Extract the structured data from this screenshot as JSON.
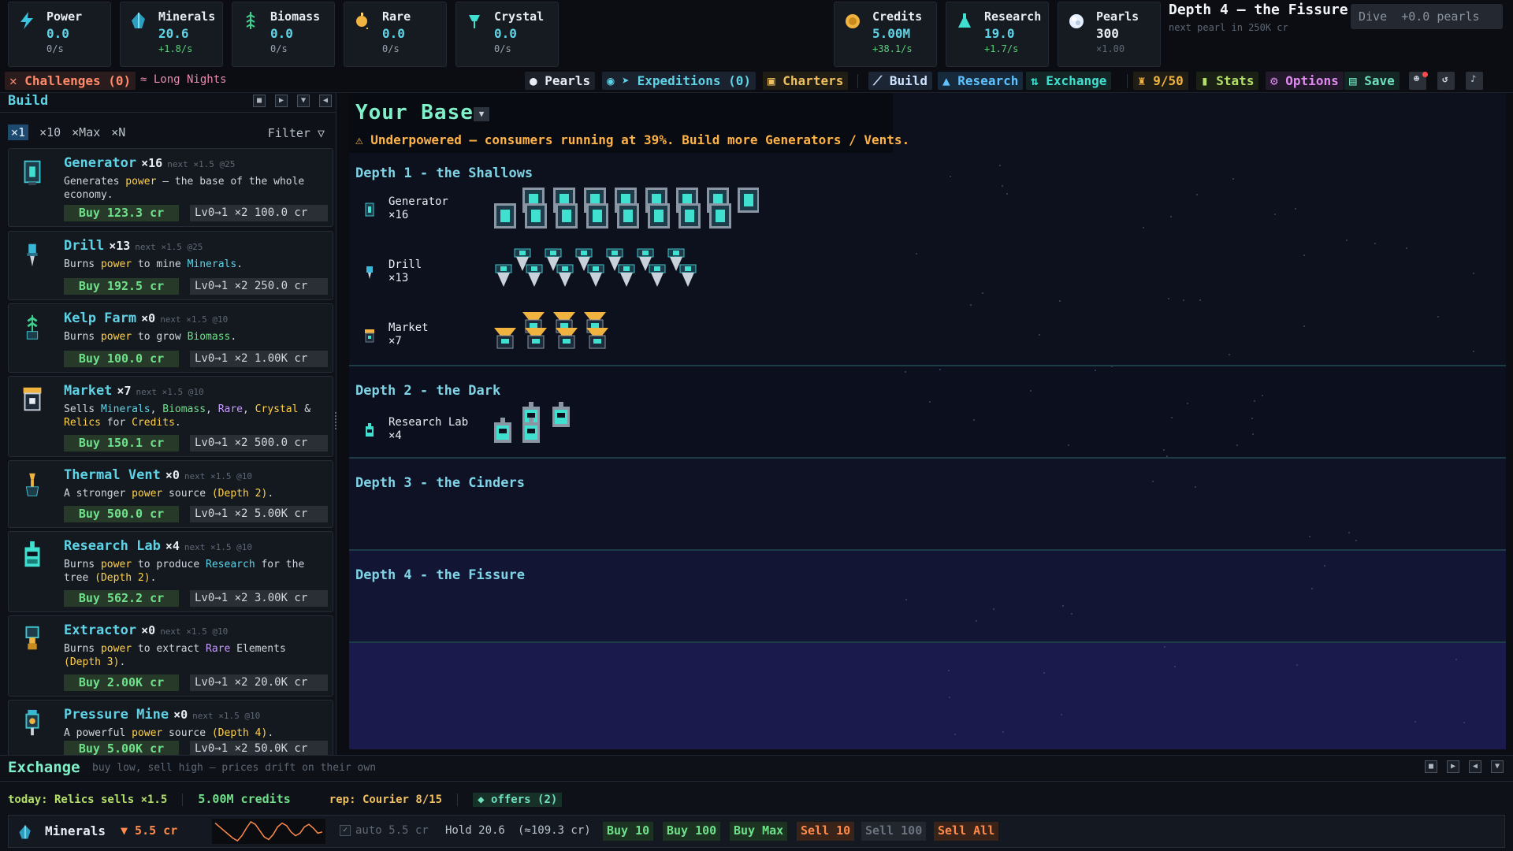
{
  "resources": [
    {
      "name": "Power",
      "value": "0.0",
      "rate": "0/s",
      "rate_positive": false,
      "color": "#5fd3e6"
    },
    {
      "name": "Minerals",
      "value": "20.6",
      "rate": "+1.8/s",
      "rate_positive": true,
      "color": "#3bb7d6"
    },
    {
      "name": "Biomass",
      "value": "0.0",
      "rate": "0/s",
      "rate_positive": false,
      "color": "#3fcf8e"
    },
    {
      "name": "Rare",
      "value": "0.0",
      "rate": "0/s",
      "rate_positive": false,
      "color": "#f0b340"
    },
    {
      "name": "Crystal",
      "value": "0.0",
      "rate": "0/s",
      "rate_positive": false,
      "color": "#3fe0d0"
    }
  ],
  "currencies": [
    {
      "name": "Credits",
      "value": "5.00M",
      "rate": "+38.1/s"
    },
    {
      "name": "Research",
      "value": "19.0",
      "rate": "+1.7/s"
    },
    {
      "name": "Pearls",
      "value": "300",
      "rate": "×1.00"
    }
  ],
  "depth": {
    "title": "Depth 4 — the Fissure",
    "next_pearl": "next pearl in 250K cr",
    "dive_label": "Dive",
    "dive_gain": "+0.0 pearls"
  },
  "nav": {
    "challenges": "Challenges (0)",
    "long_nights": "≈ Long Nights",
    "pearls": "Pearls",
    "expeditions": "Expeditions (0)",
    "charters": "Charters",
    "build": "Build",
    "research": "Research",
    "exchange": "Exchange",
    "trophies": "9/50",
    "stats": "Stats",
    "options": "Options",
    "save": "Save"
  },
  "build": {
    "title": "Build",
    "multipliers": [
      "×1",
      "×10",
      "×Max",
      "×N"
    ],
    "filter": "Filter ▽",
    "cards": [
      {
        "name": "Generator",
        "count": "×16",
        "next": "next ×1.5 @25",
        "desc_parts": [
          [
            "Generates ",
            ""
          ],
          [
            "power",
            "hp"
          ],
          [
            " — the base of the whole economy.",
            ""
          ]
        ],
        "buy": "Buy 123.3 cr",
        "lvl": "Lv0→1 ×2  100.0 cr"
      },
      {
        "name": "Drill",
        "count": "×13",
        "next": "next ×1.5 @25",
        "desc_parts": [
          [
            "Burns ",
            ""
          ],
          [
            "power",
            "hp"
          ],
          [
            " to mine ",
            ""
          ],
          [
            "Minerals",
            "hm"
          ],
          [
            ".",
            ""
          ]
        ],
        "buy": "Buy 192.5 cr",
        "lvl": "Lv0→1 ×2  250.0 cr"
      },
      {
        "name": "Kelp Farm",
        "count": "×0",
        "next": "next ×1.5 @10",
        "desc_parts": [
          [
            "Burns ",
            ""
          ],
          [
            "power",
            "hp"
          ],
          [
            " to grow ",
            ""
          ],
          [
            "Biomass",
            "hb"
          ],
          [
            ".",
            ""
          ]
        ],
        "buy": "Buy 100.0 cr",
        "lvl": "Lv0→1 ×2  1.00K cr"
      },
      {
        "name": "Market",
        "count": "×7",
        "next": "next ×1.5 @10",
        "desc_parts": [
          [
            "Sells ",
            ""
          ],
          [
            "Minerals",
            "hm"
          ],
          [
            ", ",
            ""
          ],
          [
            "Biomass",
            "hb"
          ],
          [
            ", ",
            ""
          ],
          [
            "Rare",
            "hr"
          ],
          [
            ", ",
            ""
          ],
          [
            "Crystal",
            "hcr"
          ],
          [
            " & ",
            ""
          ],
          [
            "Relics",
            "hre"
          ],
          [
            " for ",
            ""
          ],
          [
            "Credits",
            "hp"
          ],
          [
            ".",
            ""
          ]
        ],
        "buy": "Buy 150.1 cr",
        "lvl": "Lv0→1 ×2  500.0 cr"
      },
      {
        "name": "Thermal Vent",
        "count": "×0",
        "next": "next ×1.5 @10",
        "desc_parts": [
          [
            "A stronger ",
            ""
          ],
          [
            "power",
            "hp"
          ],
          [
            " source ",
            ""
          ],
          [
            "(Depth 2)",
            "hd"
          ],
          [
            ".",
            ""
          ]
        ],
        "buy": "Buy 500.0 cr",
        "lvl": "Lv0→1 ×2  5.00K cr"
      },
      {
        "name": "Research Lab",
        "count": "×4",
        "next": "next ×1.5 @10",
        "desc_parts": [
          [
            "Burns ",
            ""
          ],
          [
            "power",
            "hp"
          ],
          [
            " to produce ",
            ""
          ],
          [
            "Research",
            "hres"
          ],
          [
            " for the tree ",
            ""
          ],
          [
            "(Depth 2)",
            "hd"
          ],
          [
            ".",
            ""
          ]
        ],
        "buy": "Buy 562.2 cr",
        "lvl": "Lv0→1 ×2  3.00K cr"
      },
      {
        "name": "Extractor",
        "count": "×0",
        "next": "next ×1.5 @10",
        "desc_parts": [
          [
            "Burns ",
            ""
          ],
          [
            "power",
            "hp"
          ],
          [
            " to extract ",
            ""
          ],
          [
            "Rare",
            "hr"
          ],
          [
            " Elements ",
            ""
          ],
          [
            "(Depth 3)",
            "hd"
          ],
          [
            ".",
            ""
          ]
        ],
        "buy": "Buy 2.00K cr",
        "lvl": "Lv0→1 ×2  20.0K cr"
      },
      {
        "name": "Pressure Mine",
        "count": "×0",
        "next": "next ×1.5 @10",
        "desc_parts": [
          [
            "A powerful ",
            ""
          ],
          [
            "power",
            "hp"
          ],
          [
            " source ",
            ""
          ],
          [
            "(Depth 4)",
            "hd"
          ],
          [
            ".",
            ""
          ]
        ],
        "buy": "Buy 5.00K cr",
        "lvl": "Lv0→1 ×2  50.0K cr"
      }
    ]
  },
  "base": {
    "title": "Your Base",
    "warning": "⚠ Underpowered — consumers running at 39%. Build more Generators / Vents.",
    "depths": [
      {
        "label": "Depth 1 - the Shallows",
        "buildings": [
          {
            "name": "Generator",
            "count": "×16"
          },
          {
            "name": "Drill",
            "count": "×13"
          },
          {
            "name": "Market",
            "count": "×7"
          }
        ]
      },
      {
        "label": "Depth 2 - the Dark",
        "buildings": [
          {
            "name": "Research Lab",
            "count": "×4"
          }
        ]
      },
      {
        "label": "Depth 3 - the Cinders",
        "buildings": []
      },
      {
        "label": "Depth 4 - the Fissure",
        "buildings": []
      }
    ]
  },
  "exchange": {
    "title": "Exchange",
    "subtitle": "buy low, sell high — prices drift on their own",
    "today": "today: Relics sells ×1.5",
    "credits": "5.00M credits",
    "rep": "rep: Courier 8/15",
    "offers": "◆ offers (2)",
    "item": {
      "name": "Minerals",
      "price": "▼ 5.5 cr",
      "auto": "auto 5.5 cr",
      "hold": "Hold 20.6",
      "hold_value": "(≈109.3 cr)"
    },
    "buttons": [
      "Buy 10",
      "Buy 100",
      "Buy Max",
      "Sell 10",
      "Sell 100",
      "Sell All"
    ],
    "sparkline": [
      6.2,
      5.9,
      5.6,
      5.3,
      5.0,
      4.8,
      5.2,
      5.8,
      6.3,
      6.1,
      5.6,
      5.1,
      4.9,
      5.3,
      5.9,
      6.2,
      6.0,
      5.5,
      5.2,
      5.4,
      5.9,
      6.1,
      5.8,
      5.4,
      5.5
    ]
  }
}
